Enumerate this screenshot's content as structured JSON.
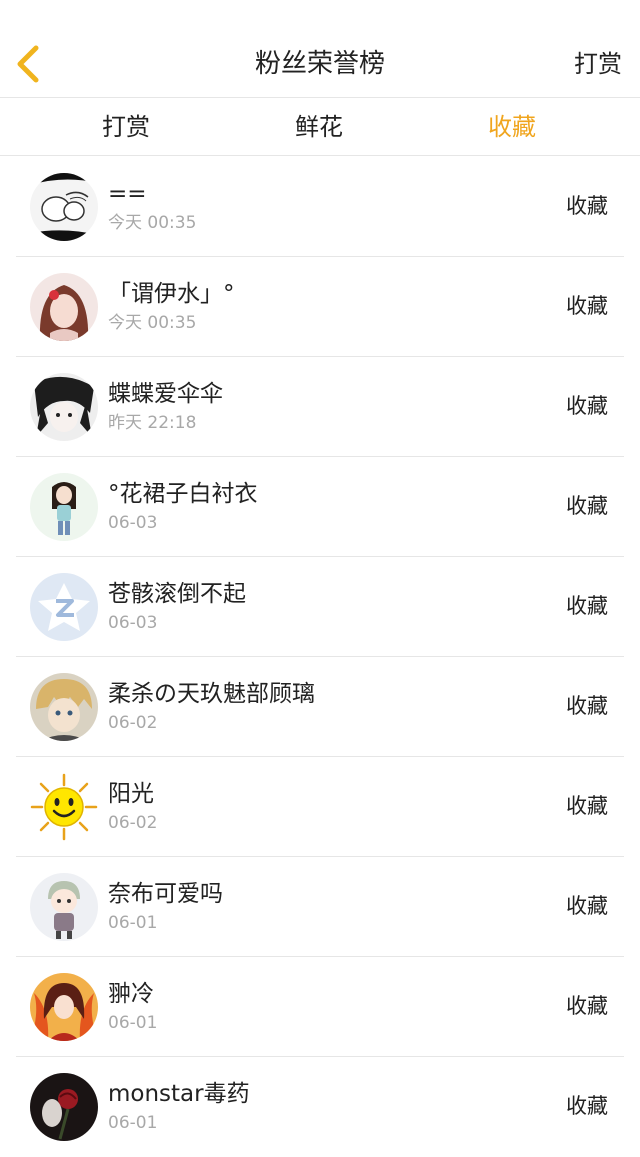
{
  "nav": {
    "title": "粉丝荣誉榜",
    "right_label": "打赏"
  },
  "tabs": [
    {
      "label": "打赏"
    },
    {
      "label": "鲜花"
    },
    {
      "label": "收藏"
    }
  ],
  "active_tab": 2,
  "colors": {
    "accent": "#f0a51e"
  },
  "rows": [
    {
      "name": "==",
      "time": "今天 00:35",
      "action": "收藏"
    },
    {
      "name": "「谓伊水」°",
      "time": "今天 00:35",
      "action": "收藏"
    },
    {
      "name": "蝶蝶爱伞伞",
      "time": "昨天 22:18",
      "action": "收藏"
    },
    {
      "name": "°花裙子白衬衣",
      "time": "06-03",
      "action": "收藏"
    },
    {
      "name": "苍骸滚倒不起",
      "time": "06-03",
      "action": "收藏"
    },
    {
      "name": "柔杀の天玖魅部顾璃",
      "time": "06-02",
      "action": "收藏"
    },
    {
      "name": "阳光",
      "time": "06-02",
      "action": "收藏"
    },
    {
      "name": "奈布可爱吗",
      "time": "06-01",
      "action": "收藏"
    },
    {
      "name": "翀冷",
      "time": "06-01",
      "action": "收藏"
    },
    {
      "name": "monstar毒药",
      "time": "06-01",
      "action": "收藏"
    }
  ]
}
